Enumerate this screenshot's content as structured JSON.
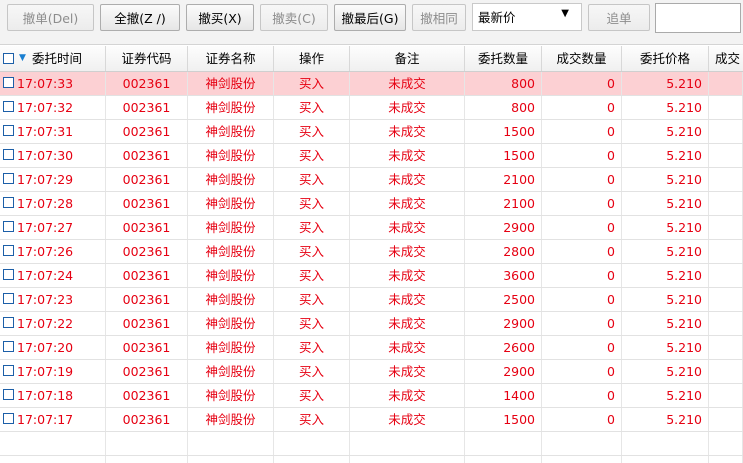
{
  "toolbar": {
    "buttons": [
      {
        "label": "撤单(Del)",
        "enabled": false
      },
      {
        "label": "全撤(Z /)",
        "enabled": true
      },
      {
        "label": "撤买(X)",
        "enabled": true
      },
      {
        "label": "撤卖(C)",
        "enabled": false
      },
      {
        "label": "撤最后(G)",
        "enabled": true
      },
      {
        "label": "撤相同",
        "enabled": false
      }
    ],
    "price_select": {
      "value": "最新价"
    },
    "chase_button": {
      "label": "追单",
      "enabled": false
    },
    "input_value": ""
  },
  "table": {
    "columns": [
      "委托时间",
      "证券代码",
      "证券名称",
      "操作",
      "备注",
      "委托数量",
      "成交数量",
      "委托价格",
      "成交"
    ],
    "rows": [
      {
        "time": "17:07:33",
        "code": "002361",
        "name": "神剑股份",
        "op": "买入",
        "note": "未成交",
        "qty": "800",
        "filled": "0",
        "price": "5.210",
        "selected": true
      },
      {
        "time": "17:07:32",
        "code": "002361",
        "name": "神剑股份",
        "op": "买入",
        "note": "未成交",
        "qty": "800",
        "filled": "0",
        "price": "5.210"
      },
      {
        "time": "17:07:31",
        "code": "002361",
        "name": "神剑股份",
        "op": "买入",
        "note": "未成交",
        "qty": "1500",
        "filled": "0",
        "price": "5.210"
      },
      {
        "time": "17:07:30",
        "code": "002361",
        "name": "神剑股份",
        "op": "买入",
        "note": "未成交",
        "qty": "1500",
        "filled": "0",
        "price": "5.210"
      },
      {
        "time": "17:07:29",
        "code": "002361",
        "name": "神剑股份",
        "op": "买入",
        "note": "未成交",
        "qty": "2100",
        "filled": "0",
        "price": "5.210"
      },
      {
        "time": "17:07:28",
        "code": "002361",
        "name": "神剑股份",
        "op": "买入",
        "note": "未成交",
        "qty": "2100",
        "filled": "0",
        "price": "5.210"
      },
      {
        "time": "17:07:27",
        "code": "002361",
        "name": "神剑股份",
        "op": "买入",
        "note": "未成交",
        "qty": "2900",
        "filled": "0",
        "price": "5.210"
      },
      {
        "time": "17:07:26",
        "code": "002361",
        "name": "神剑股份",
        "op": "买入",
        "note": "未成交",
        "qty": "2800",
        "filled": "0",
        "price": "5.210"
      },
      {
        "time": "17:07:24",
        "code": "002361",
        "name": "神剑股份",
        "op": "买入",
        "note": "未成交",
        "qty": "3600",
        "filled": "0",
        "price": "5.210"
      },
      {
        "time": "17:07:23",
        "code": "002361",
        "name": "神剑股份",
        "op": "买入",
        "note": "未成交",
        "qty": "2500",
        "filled": "0",
        "price": "5.210"
      },
      {
        "time": "17:07:22",
        "code": "002361",
        "name": "神剑股份",
        "op": "买入",
        "note": "未成交",
        "qty": "2900",
        "filled": "0",
        "price": "5.210"
      },
      {
        "time": "17:07:20",
        "code": "002361",
        "name": "神剑股份",
        "op": "买入",
        "note": "未成交",
        "qty": "2600",
        "filled": "0",
        "price": "5.210"
      },
      {
        "time": "17:07:19",
        "code": "002361",
        "name": "神剑股份",
        "op": "买入",
        "note": "未成交",
        "qty": "2900",
        "filled": "0",
        "price": "5.210"
      },
      {
        "time": "17:07:18",
        "code": "002361",
        "name": "神剑股份",
        "op": "买入",
        "note": "未成交",
        "qty": "1400",
        "filled": "0",
        "price": "5.210"
      },
      {
        "time": "17:07:17",
        "code": "002361",
        "name": "神剑股份",
        "op": "买入",
        "note": "未成交",
        "qty": "1500",
        "filled": "0",
        "price": "5.210"
      }
    ]
  },
  "colors": {
    "row_text": "#e60012",
    "selected_row": "#fcd0d3",
    "checkbox_border": "#1c5fa8",
    "sort_indicator": "#1a7fd1"
  }
}
